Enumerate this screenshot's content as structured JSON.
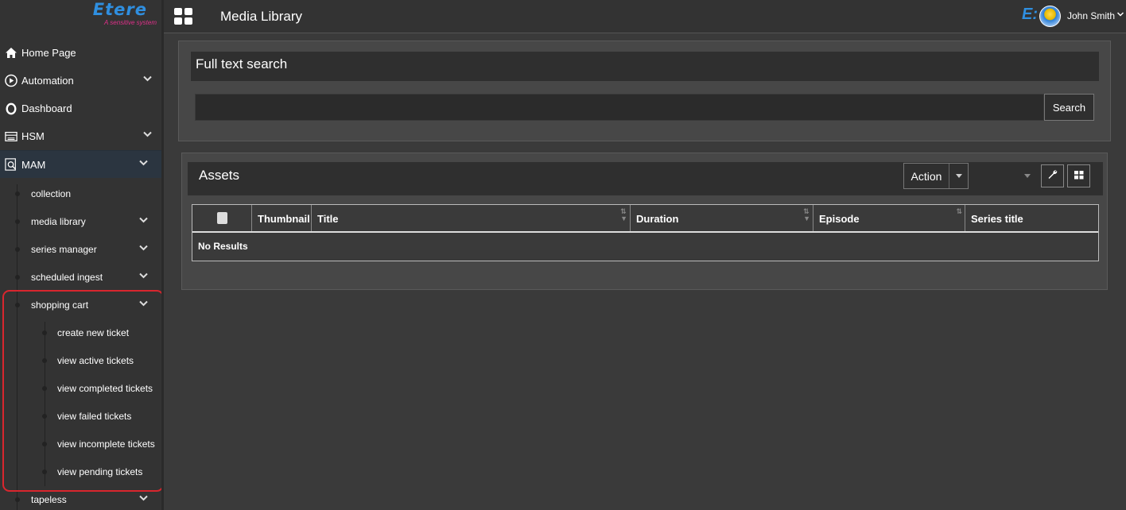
{
  "logo": {
    "name": "Etere",
    "tagline": "A sensitive system"
  },
  "topbar": {
    "page_title": "Media Library",
    "user_name": "John Smith"
  },
  "sidebar": {
    "items": [
      {
        "label": "Home Page",
        "icon": "home-icon",
        "has_children": false
      },
      {
        "label": "Automation",
        "icon": "play-circle-icon",
        "has_children": true
      },
      {
        "label": "Dashboard",
        "icon": "circle-icon",
        "has_children": false
      },
      {
        "label": "HSM",
        "icon": "storage-icon",
        "has_children": true
      },
      {
        "label": "MAM",
        "icon": "search-doc-icon",
        "has_children": true,
        "active": true
      }
    ],
    "mam_children": [
      {
        "label": "collection",
        "has_children": false
      },
      {
        "label": "media library",
        "has_children": true
      },
      {
        "label": "series manager",
        "has_children": true
      },
      {
        "label": "scheduled ingest",
        "has_children": true
      },
      {
        "label": "shopping cart",
        "has_children": true,
        "expanded": true
      },
      {
        "label": "tapeless",
        "has_children": true
      }
    ],
    "shopping_cart_children": [
      "create new ticket",
      "view active tickets",
      "view completed tickets",
      "view failed tickets",
      "view incomplete tickets",
      "view pending tickets"
    ]
  },
  "search": {
    "title": "Full text search",
    "value": "",
    "button_label": "Search"
  },
  "assets": {
    "title": "Assets",
    "action_label": "Action",
    "columns": [
      "Thumbnail",
      "Title",
      "Duration",
      "Episode",
      "Series title"
    ],
    "empty_message": "No Results"
  },
  "colors": {
    "highlight_border": "#d9262e",
    "brand": "#2f8fe0"
  }
}
